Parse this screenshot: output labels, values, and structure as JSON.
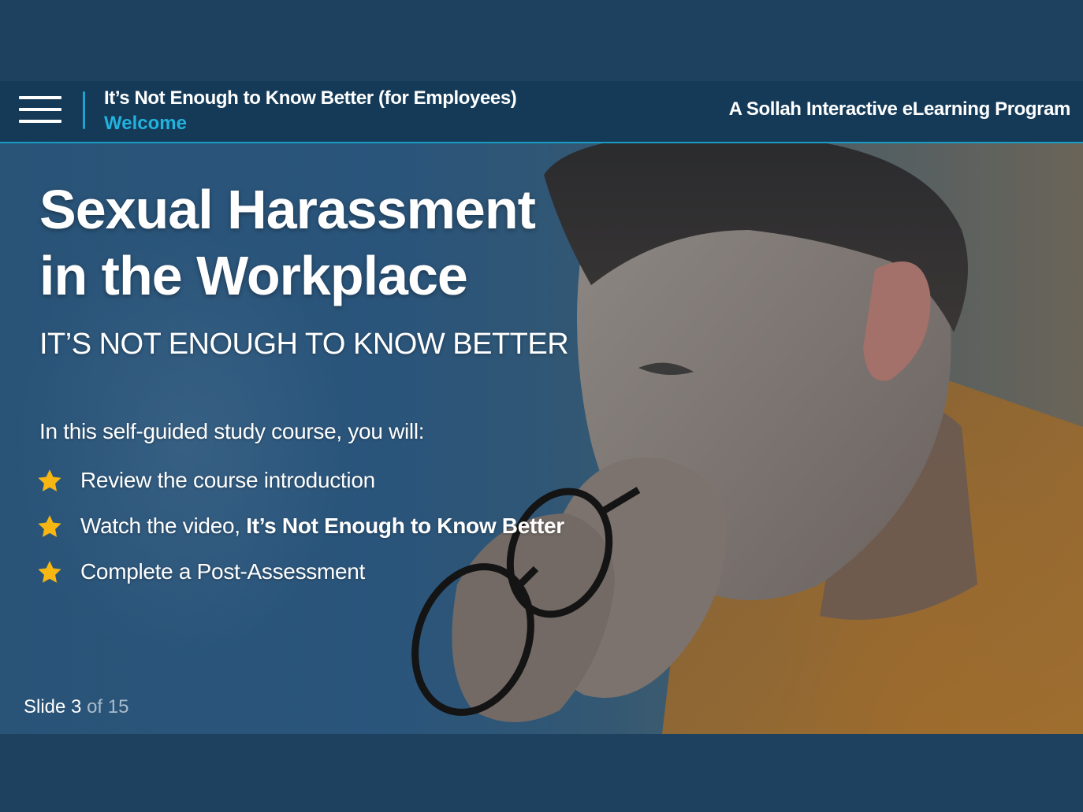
{
  "header": {
    "course_title": "It’s Not Enough to Know Better (for Employees)",
    "section_title": "Welcome",
    "program_title": "A Sollah Interactive eLearning Program"
  },
  "slide": {
    "headline_line1": "Sexual Harassment",
    "headline_line2": "in the Workplace",
    "subheadline": "IT’S NOT ENOUGH TO KNOW BETTER",
    "intro": "In this self-guided study course, you will:",
    "items": [
      {
        "icon": "star-icon",
        "text": "Review the course introduction",
        "bold": ""
      },
      {
        "icon": "star-icon",
        "text": "Watch the video, ",
        "bold": "It’s Not Enough to Know Better"
      },
      {
        "icon": "star-icon",
        "text": "Complete a Post-Assessment",
        "bold": ""
      }
    ]
  },
  "footer": {
    "slide_label": "Slide",
    "current": "3",
    "of_label": "of",
    "total": "15"
  },
  "colors": {
    "frame": "#1d415e",
    "header_bar": "#143a58",
    "accent": "#22b2dd",
    "star": "#f6b613"
  }
}
